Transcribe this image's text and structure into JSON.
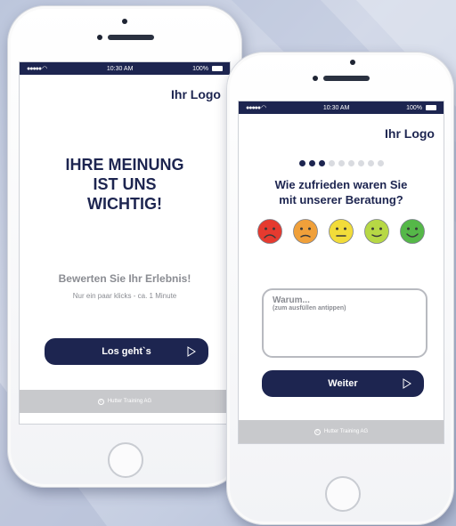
{
  "phone1": {
    "status": {
      "signal": "●●●●● ",
      "time": "10:30 AM",
      "battery": "100%"
    },
    "logo": "Ihr Logo",
    "headline": [
      "IHRE MEINUNG",
      "IST UNS",
      "WICHTIG!"
    ],
    "subhead": "Bewerten Sie Ihr Erlebnis!",
    "note": "Nur ein paar klicks - ca. 1 Minute",
    "start_button": "Los geht`s",
    "footer": "Hutter Training AG"
  },
  "phone2": {
    "status": {
      "signal": "●●●●● ",
      "time": "10:30 AM",
      "battery": "100%"
    },
    "logo": "Ihr Logo",
    "progress": {
      "current": 3,
      "total": 9
    },
    "question": [
      "Wie zufrieden waren Sie",
      "mit unserer Beratung?"
    ],
    "ratings": [
      {
        "icon": "very-unhappy-face-icon",
        "color": "#e53a2f"
      },
      {
        "icon": "unhappy-face-icon",
        "color": "#f0a03a"
      },
      {
        "icon": "neutral-face-icon",
        "color": "#f2dc3a"
      },
      {
        "icon": "happy-face-icon",
        "color": "#b7d845"
      },
      {
        "icon": "very-happy-face-icon",
        "color": "#55b848"
      }
    ],
    "comment": {
      "title": "Warum...",
      "hint": "(zum ausfüllen antippen)"
    },
    "next_button": "Weiter",
    "footer": "Hutter Training AG"
  },
  "colors": {
    "primary": "#1d2550",
    "footer_bg": "#c8c9cc",
    "muted_text": "#8a8c92"
  }
}
